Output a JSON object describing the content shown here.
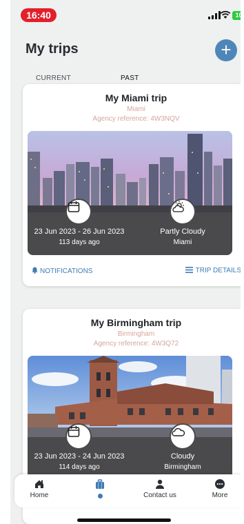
{
  "status_bar": {
    "time": "16:40",
    "battery": "100"
  },
  "header": {
    "title": "My trips",
    "add_label": "+"
  },
  "tabs": [
    {
      "label": "CURRENT",
      "active": false
    },
    {
      "label": "PAST",
      "active": true
    }
  ],
  "trips": [
    {
      "name": "My Miami trip",
      "city": "Miami",
      "agency_reference": "Agency reference: 4W3NQV",
      "dates": "23 Jun 2023 - 26 Jun 2023",
      "ago": "113 days ago",
      "weather": "Partly Cloudy",
      "weather_location": "Miami",
      "weather_icon": "partly-cloudy-icon",
      "notifications_label": "NOTIFICATIONS",
      "details_label": "TRIP DETAILS"
    },
    {
      "name": "My Birmingham trip",
      "city": "Birmingham",
      "agency_reference": "Agency reference: 4W3Q72",
      "dates": "23 Jun 2023 - 24 Jun 2023",
      "ago": "114 days ago",
      "weather": "Cloudy",
      "weather_location": "Birmingham",
      "weather_icon": "cloud-icon"
    }
  ],
  "bottom_nav": {
    "items": [
      {
        "label": "Home",
        "icon": "home-icon"
      },
      {
        "label": "",
        "icon": "suitcase-icon",
        "active": true
      },
      {
        "label": "Contact us",
        "icon": "person-icon"
      },
      {
        "label": "More",
        "icon": "more-icon"
      }
    ]
  },
  "colors": {
    "accent": "#3d7bb5",
    "add_button": "#4f86b8",
    "reference_text": "#d4a59a",
    "time_pill": "#e3202a"
  }
}
